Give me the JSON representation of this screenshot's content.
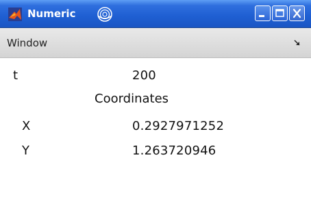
{
  "window": {
    "title": "Numeric",
    "controls": {
      "minimize_icon": "minimize-icon",
      "maximize_icon": "maximize-icon",
      "close_icon": "close-icon"
    },
    "title_bar_color": "#1f5fd2"
  },
  "menu": {
    "window_label": "Window",
    "dock_icon": "dock-arrow-icon"
  },
  "content": {
    "t_label": "t",
    "t_value": "200",
    "section_title": "Coordinates",
    "x_label": "X",
    "x_value": "0.2927971252",
    "y_label": "Y",
    "y_value": "1.263720946"
  }
}
